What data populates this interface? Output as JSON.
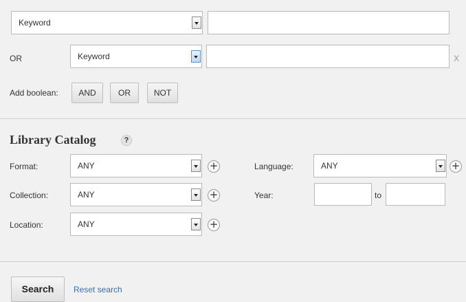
{
  "query_row1": {
    "field": "Keyword",
    "text": ""
  },
  "query_row2": {
    "operator": "OR",
    "field": "Keyword",
    "text": "",
    "remove": "X"
  },
  "boolean": {
    "label": "Add boolean:",
    "and": "AND",
    "or": "OR",
    "not": "NOT"
  },
  "catalog": {
    "title": "Library Catalog",
    "help": "?",
    "format": {
      "label": "Format:",
      "value": "ANY"
    },
    "collection": {
      "label": "Collection:",
      "value": "ANY"
    },
    "location": {
      "label": "Location:",
      "value": "ANY"
    },
    "language": {
      "label": "Language:",
      "value": "ANY"
    },
    "year": {
      "label": "Year:",
      "from": "",
      "to_label": "to",
      "to": ""
    },
    "add_icon": "+"
  },
  "actions": {
    "search": "Search",
    "reset": "Reset search"
  }
}
